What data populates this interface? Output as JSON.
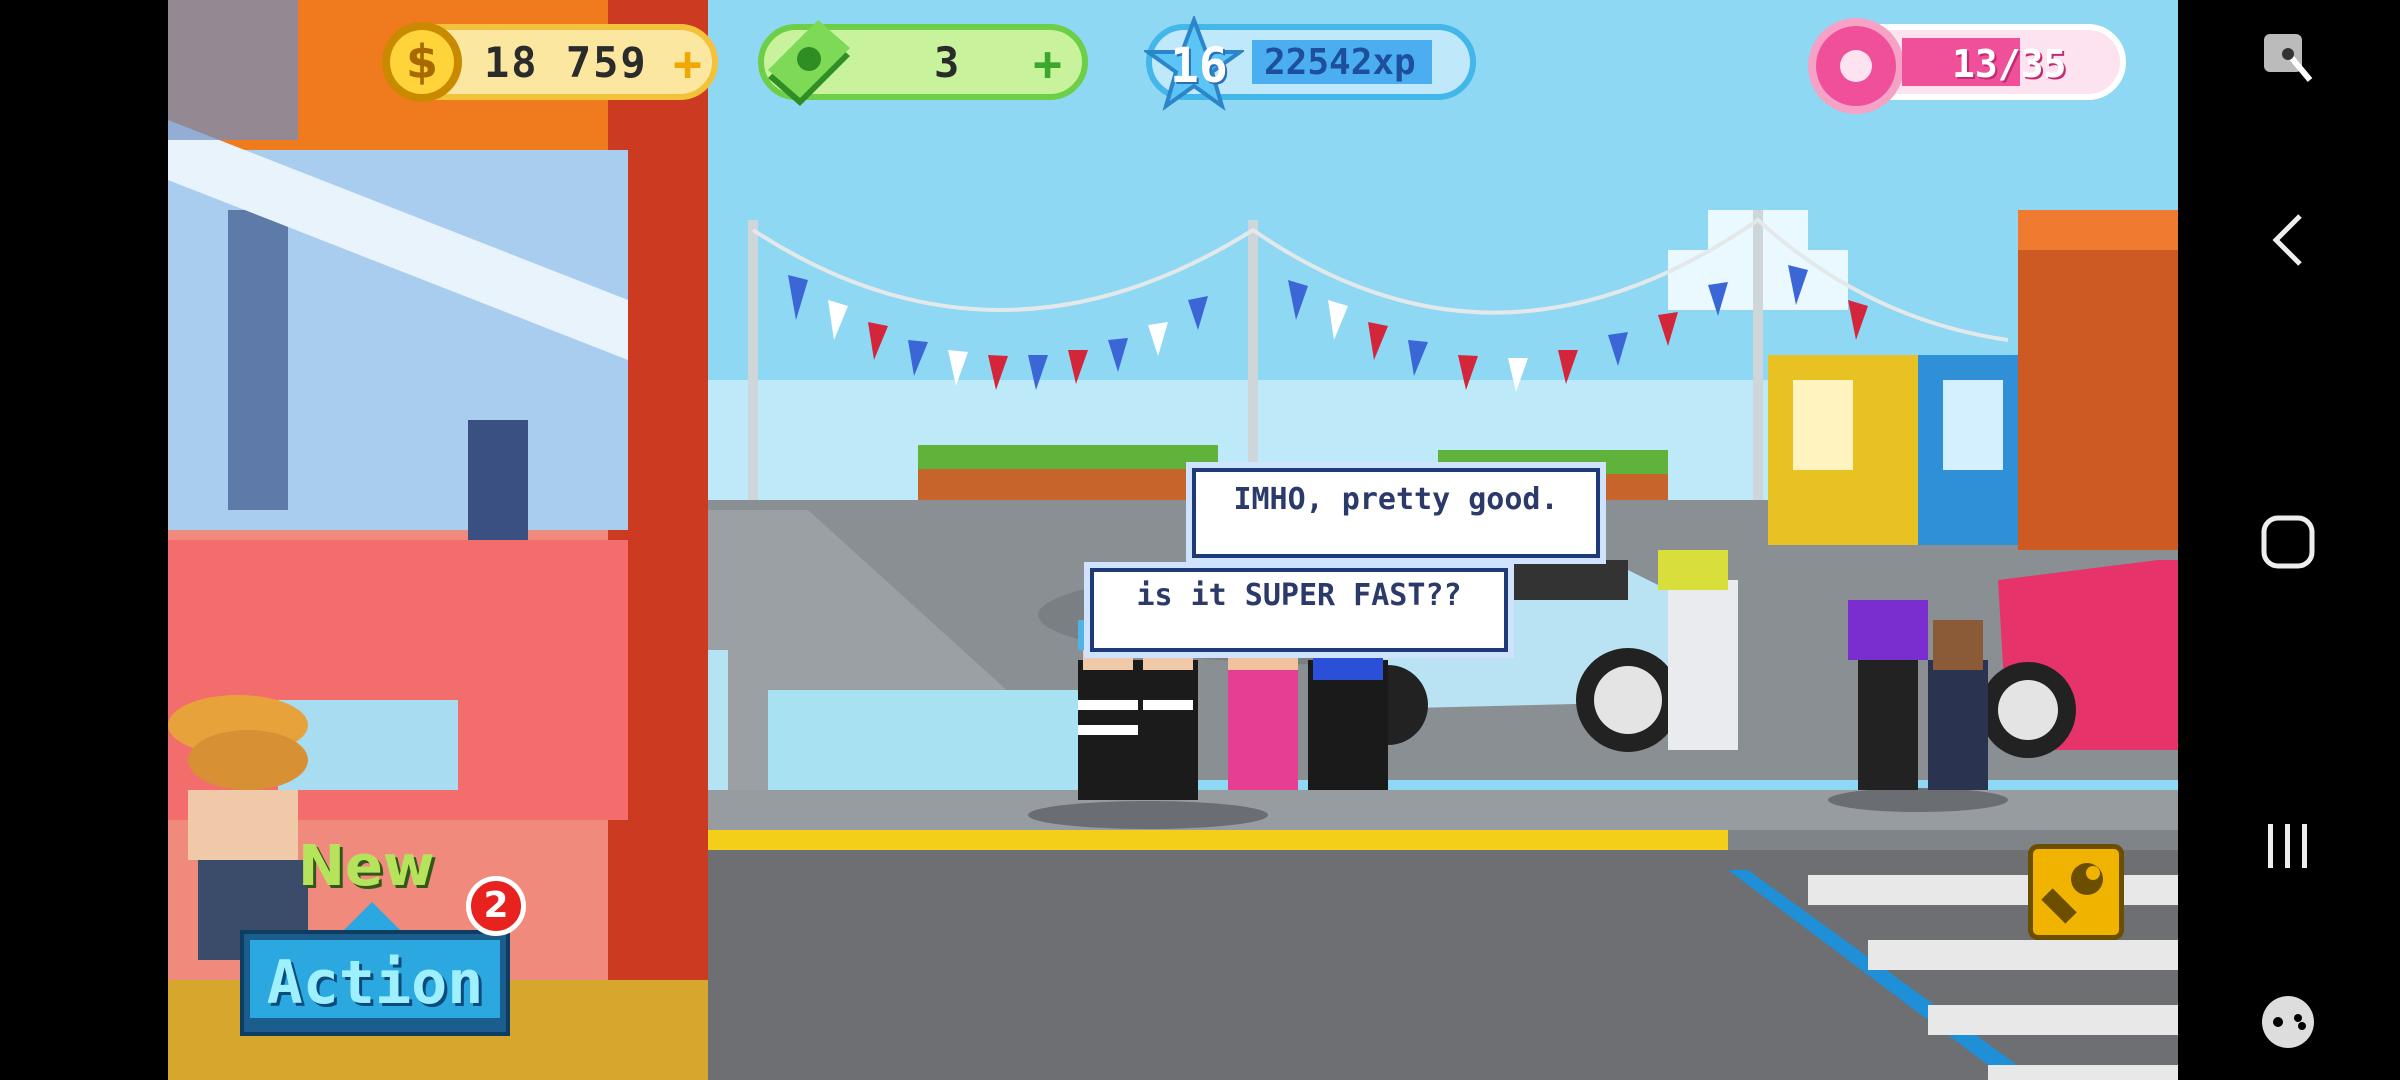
{
  "hud": {
    "coins": "18  759",
    "cash": "3",
    "level": "16",
    "xp": "22542xp",
    "donuts": "13/35",
    "colors": {
      "coins": "#f4c23a",
      "cash": "#6ccf47",
      "xp": "#43b6ea",
      "donuts": "#f04f9a"
    }
  },
  "speech": {
    "bubble1": "IMHO, pretty good.",
    "bubble2": "is it SUPER FAST??"
  },
  "actions": {
    "new_label": "New",
    "badge_count": "2",
    "action_label": "Action"
  },
  "icons": {
    "coin": "coin-icon",
    "cash": "cash-icon",
    "xp": "star-level-icon",
    "donut": "donut-icon",
    "wrench": "wrench-icon",
    "plus": "plus-icon"
  },
  "system_nav": [
    "screen-tool-icon",
    "back-icon",
    "home-icon",
    "recents-icon",
    "game-launcher-icon"
  ]
}
